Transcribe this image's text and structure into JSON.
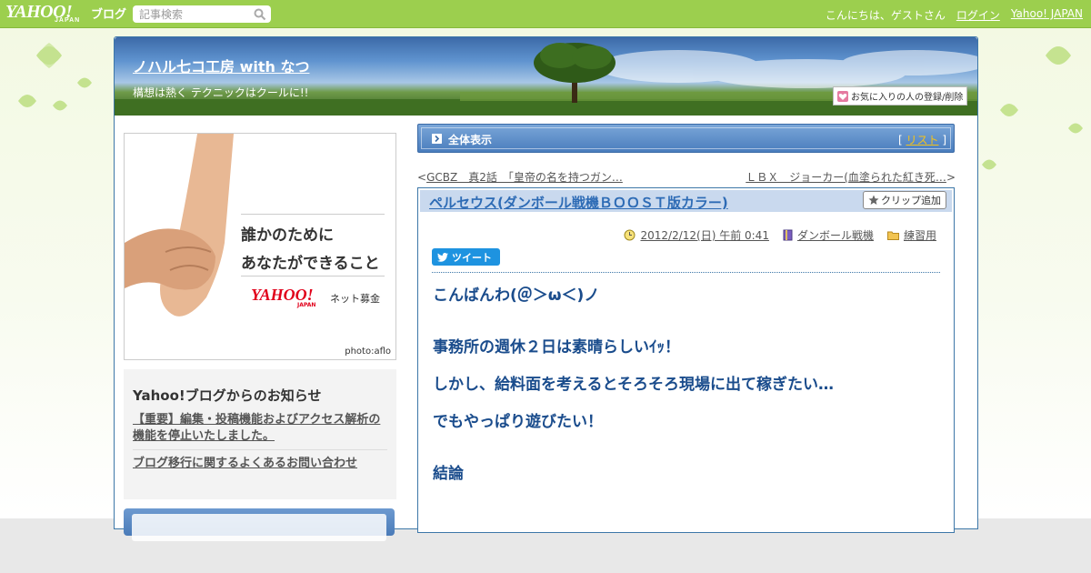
{
  "topbar": {
    "logo_text": "YAHOO!",
    "logo_sub": "JAPAN",
    "logo_blog": "ブログ",
    "search_placeholder": "記事検索",
    "greeting": "こんにちは、ゲストさん",
    "login": "ログイン",
    "yahoo_japan": "Yahoo! JAPAN"
  },
  "blog": {
    "title": "ノハル七コ工房 with なつ",
    "description": "構想は熱く テクニックはクールに!!",
    "favorite_button": "お気に入りの人の登録/削除"
  },
  "sidebar": {
    "ad": {
      "line1": "誰かのために",
      "line2": "あなたができること",
      "brand": "YAHOO!",
      "brand_sub": "JAPAN",
      "brand_service": "ネット募金",
      "credit": "photo:aflo"
    },
    "notice": {
      "heading": "Yahoo!ブログからのお知らせ",
      "items": [
        "【重要】編集・投稿機能およびアクセス解析の機能を停止いたしました。",
        "ブログ移行に関するよくあるお問い合わせ"
      ]
    }
  },
  "content": {
    "bar_label": "全体表示",
    "list_link": "リスト",
    "prev_link": "GCBZ　真2話　「皇帝の名を持つガン…",
    "next_link": "ＬＢＸ　ジョーカー(血塗られた紅き死…",
    "entry": {
      "title": "ペルセウス(ダンボール戦機ＢＯＯＳＴ版カラー)",
      "clip_button": "クリップ追加",
      "date": "2012/2/12(日) 午前 0:41",
      "category": "ダンボール戦機",
      "folder": "練習用",
      "tweet": "ツイート",
      "body": [
        "こんばんわ(＠＞ω＜)ノ",
        "事務所の週休２日は素晴らしいｲｯ！",
        "しかし、給料面を考えるとそろそろ現場に出て稼ぎたい…",
        "でもやっぱり遊びたい！",
        "結論"
      ]
    }
  }
}
